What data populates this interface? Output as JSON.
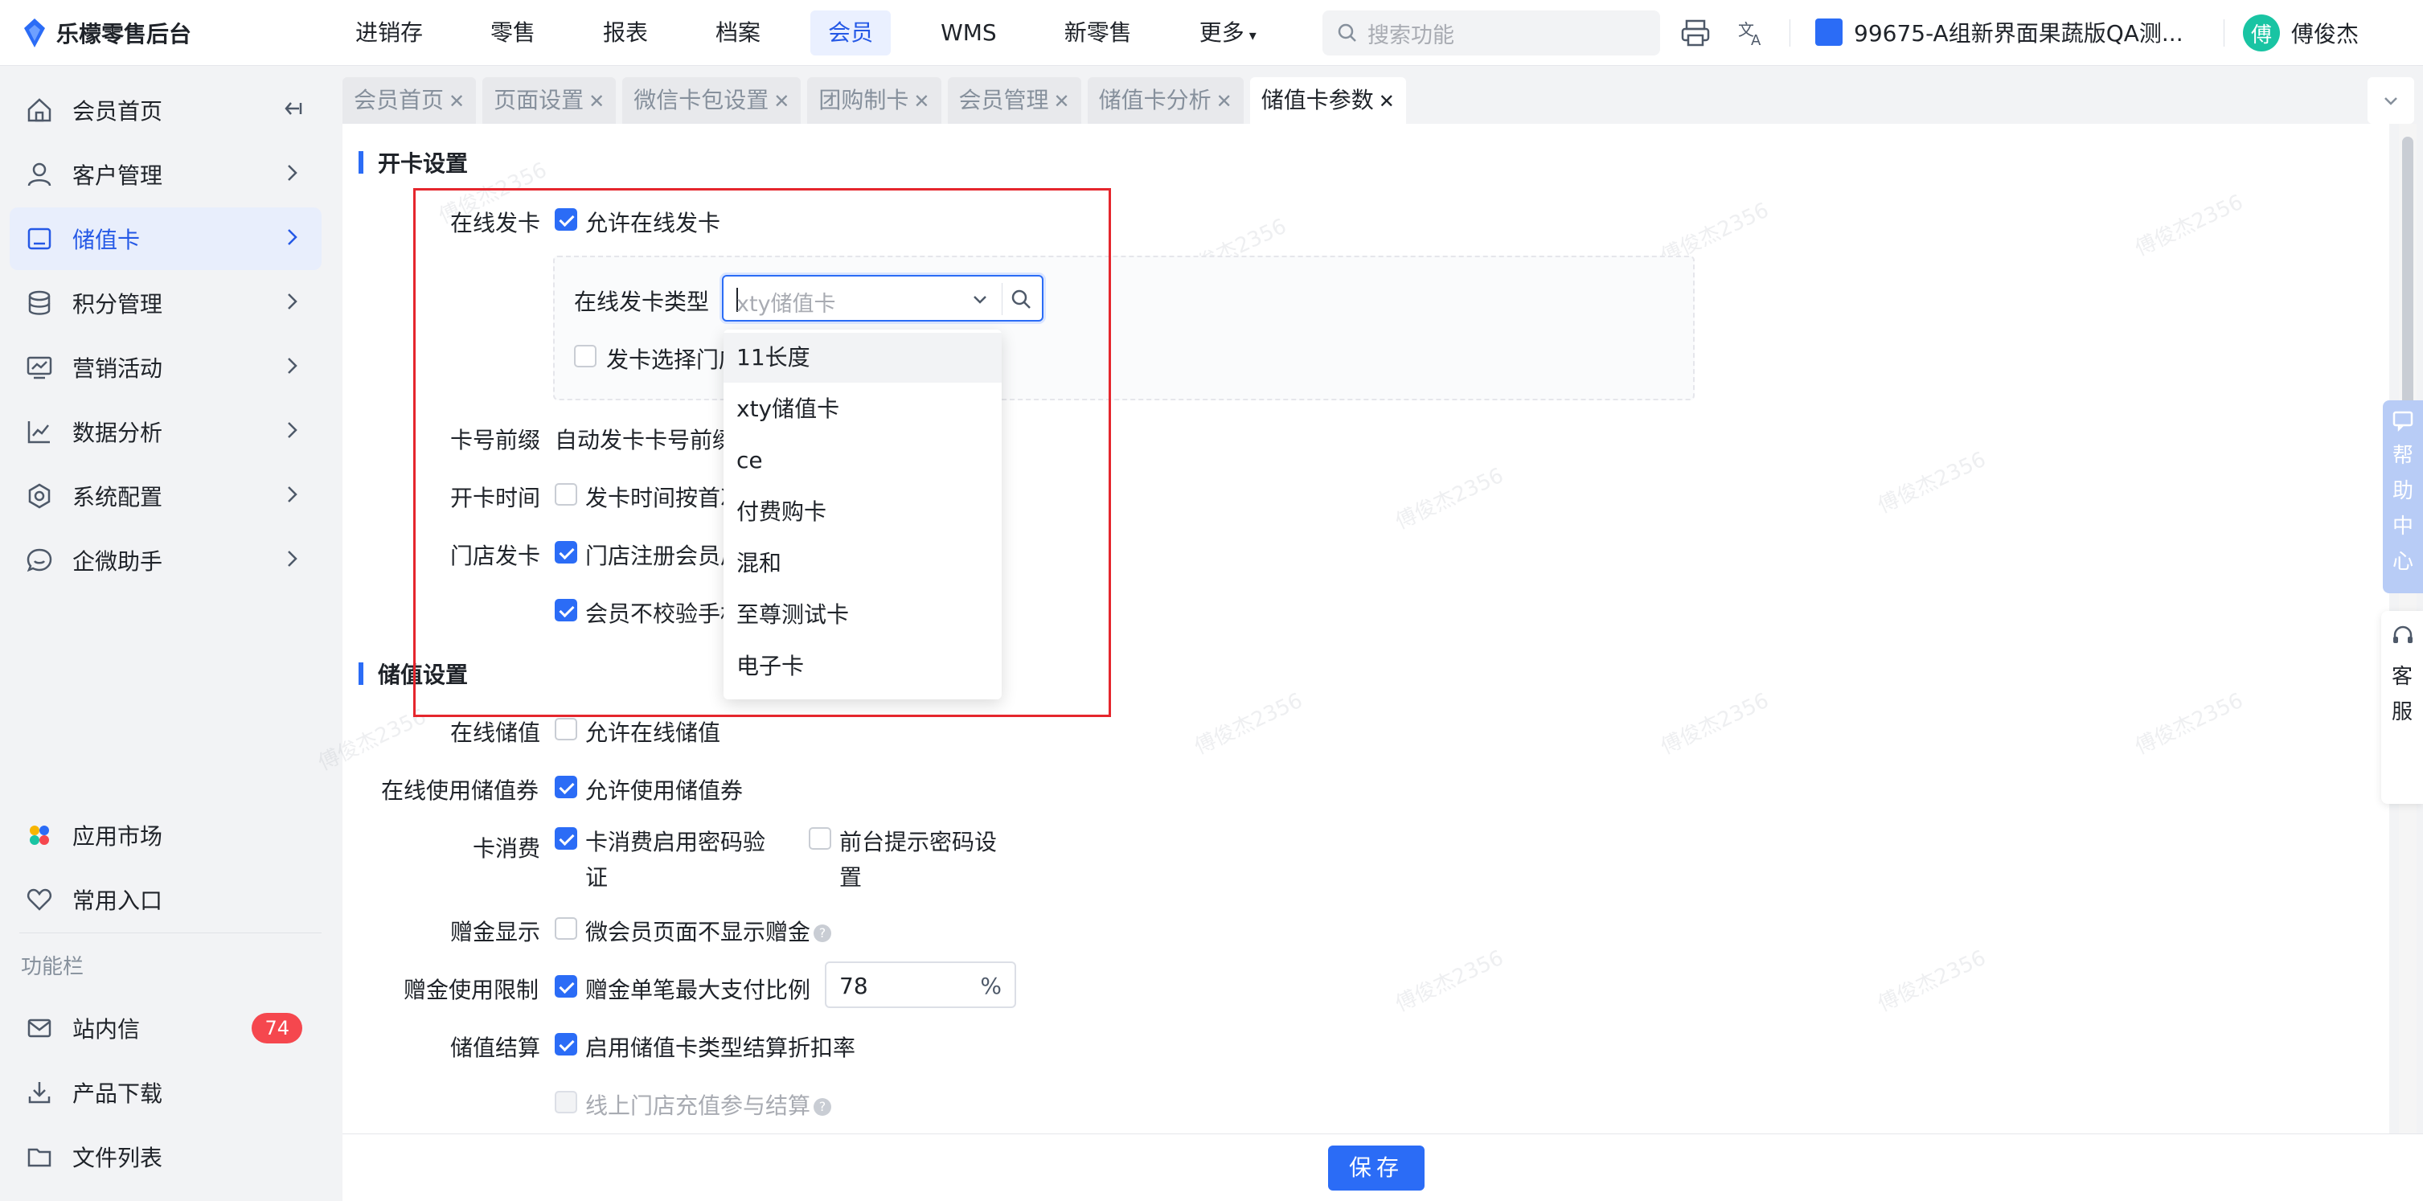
{
  "app": {
    "title": "乐檬零售后台"
  },
  "topnav": {
    "items": [
      {
        "label": "进销存",
        "caret": ""
      },
      {
        "label": "零售",
        "caret": ""
      },
      {
        "label": "报表",
        "caret": ""
      },
      {
        "label": "档案",
        "caret": ""
      },
      {
        "label": "会员",
        "caret": ""
      },
      {
        "label": "WMS",
        "caret": ""
      },
      {
        "label": "新零售",
        "caret": ""
      },
      {
        "label": "更多",
        "caret": "▾"
      }
    ],
    "active_index": 4,
    "search_placeholder": "搜索功能",
    "store_name": "99675-A组新界面果蔬版QA测...",
    "user_name": "傅俊杰",
    "user_avatar_char": "傅"
  },
  "sidebar": {
    "items": [
      {
        "label": "会员首页",
        "icon": "home-icon"
      },
      {
        "label": "客户管理",
        "icon": "user-icon"
      },
      {
        "label": "储值卡",
        "icon": "card-icon"
      },
      {
        "label": "积分管理",
        "icon": "database-icon"
      },
      {
        "label": "营销活动",
        "icon": "monitor-icon"
      },
      {
        "label": "数据分析",
        "icon": "chart-icon"
      },
      {
        "label": "系统配置",
        "icon": "settings-icon"
      },
      {
        "label": "企微助手",
        "icon": "chat-icon"
      }
    ],
    "active_index": 2,
    "bottom_items": [
      {
        "label": "应用市场",
        "icon": "apps-icon"
      },
      {
        "label": "常用入口",
        "icon": "heart-icon"
      }
    ],
    "section_label": "功能栏",
    "function_items": [
      {
        "label": "站内信",
        "icon": "mail-icon",
        "badge": "74"
      },
      {
        "label": "产品下载",
        "icon": "download-icon",
        "badge": ""
      },
      {
        "label": "文件列表",
        "icon": "folder-icon",
        "badge": ""
      }
    ]
  },
  "tabs": [
    {
      "label": "会员首页"
    },
    {
      "label": "页面设置"
    },
    {
      "label": "微信卡包设置"
    },
    {
      "label": "团购制卡"
    },
    {
      "label": "会员管理"
    },
    {
      "label": "储值卡分析"
    },
    {
      "label": "储值卡参数"
    }
  ],
  "active_tab_index": 6,
  "sections": {
    "open_card": {
      "title": "开卡设置",
      "online_issue_label": "在线发卡",
      "online_issue_checkbox": "允许在线发卡",
      "online_issue_checked": true,
      "card_type_label": "在线发卡类型",
      "card_type_placeholder": "xty储值卡",
      "choose_store_checkbox": "发卡选择门店",
      "card_prefix_label": "卡号前缀",
      "card_prefix_text": "自动发卡卡号前缀",
      "open_time_label": "开卡时间",
      "open_time_checkbox": "发卡时间按首次",
      "store_issue_label": "门店发卡",
      "store_issue_checkbox": "门店注册会员后",
      "no_verify_phone_checkbox": "会员不校验手机"
    },
    "stored_value": {
      "title": "储值设置",
      "online_recharge_label": "在线储值",
      "online_recharge_checkbox": "允许在线储值",
      "online_voucher_label": "在线使用储值券",
      "online_voucher_checkbox": "允许使用储值券",
      "card_consume_label": "卡消费",
      "card_consume_checkbox_line1": "卡消费启用密码验",
      "card_consume_checkbox_line2": "证",
      "front_prompt_checkbox_line1": "前台提示密码设",
      "front_prompt_checkbox_line2": "置",
      "bonus_display_label": "赠金显示",
      "bonus_display_checkbox": "微会员页面不显示赠金",
      "bonus_limit_label": "赠金使用限制",
      "bonus_limit_checkbox": "赠金单笔最大支付比例",
      "bonus_limit_value": "78",
      "bonus_limit_unit": "%",
      "settlement_label": "储值结算",
      "settlement_checkbox": "启用储值卡类型结算折扣率",
      "online_store_checkbox": "线上门店充值参与结算"
    }
  },
  "dropdown": {
    "options": [
      "11长度",
      "xty储值卡",
      "ce",
      "付费购卡",
      "混和",
      "至尊测试卡",
      "电子卡"
    ],
    "hover_index": 0
  },
  "save_label": "保存",
  "float": {
    "help": [
      "帮",
      "助",
      "中",
      "心"
    ],
    "service": [
      "客",
      "服"
    ]
  },
  "watermark": "傅俊杰2356",
  "colors": {
    "primary": "#2b6cf6",
    "highlight": "#e5262d",
    "badge": "#f5474e"
  }
}
